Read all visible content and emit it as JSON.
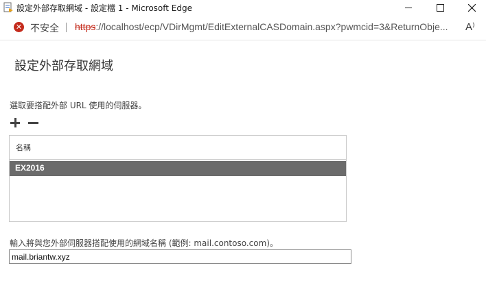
{
  "window": {
    "title": "設定外部存取網域 - 設定檔 1 - Microsoft Edge",
    "app_icon": "exchange-page-icon",
    "controls": {
      "minimize_icon": "minimize-icon",
      "maximize_icon": "maximize-icon",
      "close_icon": "close-icon"
    }
  },
  "address_bar": {
    "security_icon": "not-secure-icon",
    "security_text": "不安全",
    "url_scheme": "https",
    "url_rest": "://localhost/ecp/VDirMgmt/EditExternalCASDomain.aspx?pwmcid=3&ReturnObje...",
    "read_aloud_icon": "read-aloud-icon",
    "read_aloud_text": "A⁾"
  },
  "main": {
    "title": "設定外部存取網域",
    "instruction": "選取要搭配外部 URL 使用的伺服器。",
    "toolbar": {
      "add_icon": "plus-icon",
      "remove_icon": "minus-icon"
    },
    "server_list": {
      "column_header": "名稱",
      "rows": [
        {
          "name": "EX2016",
          "selected": true
        }
      ]
    },
    "domain_label": "輸入將與您外部伺服器搭配使用的網域名稱 (範例: mail.contoso.com)。",
    "domain_value": "mail.briantw.xyz"
  },
  "colors": {
    "selected_row": "#6b6b6b",
    "not_secure": "#c42b1c"
  }
}
